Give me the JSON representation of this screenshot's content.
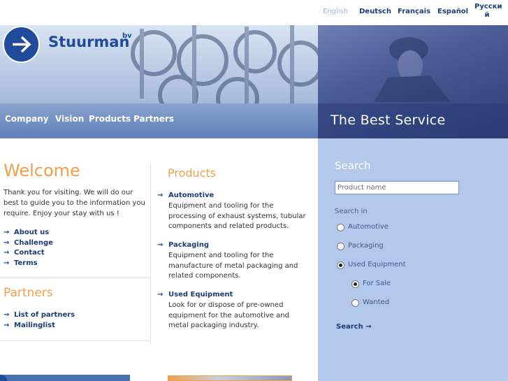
{
  "languages": [
    {
      "label": "English",
      "active": true
    },
    {
      "label": "Deutsch",
      "active": false
    },
    {
      "label": "Français",
      "active": false
    },
    {
      "label": "Español",
      "active": false
    },
    {
      "label": "Русски\nй",
      "active": false
    }
  ],
  "brand": {
    "name": "Stuurman",
    "suffix": "bv",
    "logo_icon": "arrow-right-icon",
    "color": "#1f4b9a"
  },
  "nav": [
    "Company",
    "Vision",
    "Products",
    "Partners"
  ],
  "tagline": "The Best Service",
  "welcome": {
    "title": "Welcome",
    "text": "Thank you for visiting. We will do our best to guide you to the information you require. Enjoy your stay with us !",
    "links": [
      "About us",
      "Challenge",
      "Contact",
      "Terms"
    ]
  },
  "partners": {
    "title": "Partners",
    "links": [
      "List of partners",
      "Mailinglist"
    ]
  },
  "products": {
    "title": "Products",
    "items": [
      {
        "title": "Automotive",
        "desc": "Equipment and tooling for the processing of exhaust systems, tubular components and related products."
      },
      {
        "title": "Packaging",
        "desc": "Equipment and tooling for the manufacture of metal packaging and related components."
      },
      {
        "title": "Used Equipment",
        "desc": "Look for or dispose of pre-owned equipment for the automotive and metal packaging industry."
      }
    ]
  },
  "search": {
    "title": "Search",
    "placeholder": "Product name",
    "search_in_label": "Search in",
    "options": [
      {
        "label": "Automotive",
        "checked": false
      },
      {
        "label": "Packaging",
        "checked": false
      },
      {
        "label": "Used Equipment",
        "checked": true
      }
    ],
    "sub_options": [
      {
        "label": "For Sale",
        "checked": true
      },
      {
        "label": "Wanted",
        "checked": false
      }
    ],
    "button_label": "Search"
  },
  "colors": {
    "accent_orange": "#f0a04b",
    "link_blue": "#1a3c78",
    "panel_blue": "#b3c8ea"
  }
}
